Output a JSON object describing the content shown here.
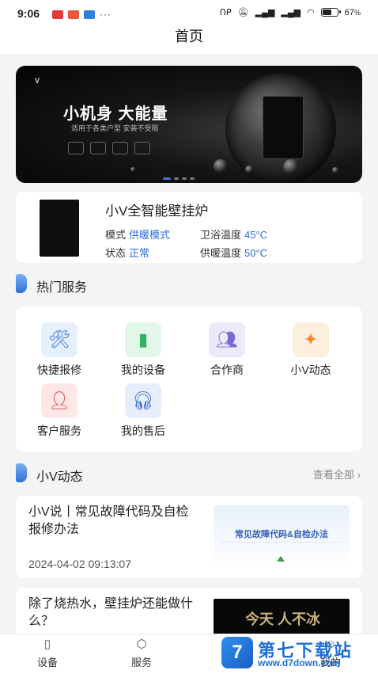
{
  "status_bar": {
    "time": "9:06",
    "dots": "···",
    "icons": [
      "nfc-icon",
      "mute-icon",
      "signal-icon",
      "signal-icon",
      "wifi-icon",
      "battery-icon"
    ],
    "battery_level_pct": 67,
    "battery_text": "67"
  },
  "header": {
    "title": "首页"
  },
  "banner": {
    "logo": "V",
    "title": "小机身 大能量",
    "subtitle": "适用于各类户型 安装不受限"
  },
  "device": {
    "name": "小V全智能壁挂炉",
    "mode_label": "模式",
    "mode_value": "供暖模式",
    "status_label": "状态",
    "status_value": "正常",
    "bath_temp_label": "卫浴温度",
    "bath_temp_value": "45°C",
    "heat_temp_label": "供暖温度",
    "heat_temp_value": "50°C"
  },
  "hot_services": {
    "title": "热门服务",
    "items": [
      {
        "label": "快捷报修",
        "icon": "repair-tools-icon",
        "bg": "#e6f0fc",
        "color": "#3a78d8"
      },
      {
        "label": "我的设备",
        "icon": "door-device-icon",
        "bg": "#e3f6ea",
        "color": "#2fb263"
      },
      {
        "label": "合作商",
        "icon": "partners-icon",
        "bg": "#ece9fb",
        "color": "#7a6ad8"
      },
      {
        "label": "小V动态",
        "icon": "pinwheel-icon",
        "bg": "#fdeedd",
        "color": "#f08a2c"
      },
      {
        "label": "客户服务",
        "icon": "customer-service-icon",
        "bg": "#fde7e7",
        "color": "#e04848"
      },
      {
        "label": "我的售后",
        "icon": "after-sales-icon",
        "bg": "#e6eefc",
        "color": "#3a6fd0"
      }
    ]
  },
  "news": {
    "title": "小V动态",
    "more": "查看全部",
    "items": [
      {
        "title": "小V说丨常见故障代码及自检报修办法",
        "time": "2024-04-02 09:13:07",
        "thumb_text": "常见故障代码&自检办法"
      },
      {
        "title": "除了烧热水，壁挂炉还能做什么？",
        "thumb_text": "今天 人不冰"
      }
    ]
  },
  "tabbar": {
    "tabs": [
      {
        "label": "设备",
        "icon": "device-icon"
      },
      {
        "label": "服务",
        "icon": "service-icon"
      },
      {
        "label": "",
        "icon": "home-icon"
      },
      {
        "label": "我的",
        "icon": "profile-icon"
      }
    ]
  },
  "watermark": {
    "logo": "7",
    "title": "第七下载站",
    "url": "www.d7down.com"
  }
}
